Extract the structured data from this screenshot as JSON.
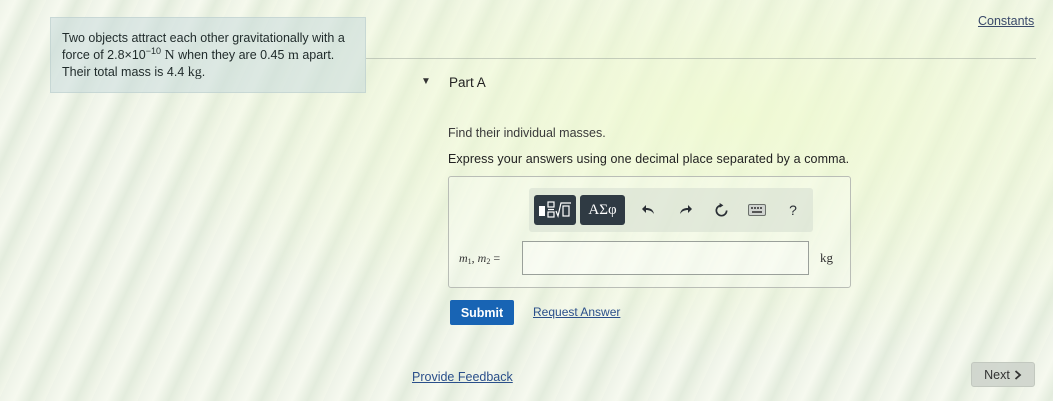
{
  "problem": {
    "line1": "Two objects attract each other gravitationally with a",
    "line2_pre": "force of 2.8×10",
    "exponent": "−10",
    "force_unit": "N",
    "line2_mid": "when they are 0.45",
    "dist_unit": "m",
    "line2_post": "apart.",
    "line3_pre": "Their total mass is 4.4",
    "mass_unit": "kg",
    "line3_post": "."
  },
  "header": {
    "constants_link": "Constants"
  },
  "part": {
    "toggle_icon": "triangle-down-icon",
    "title": "Part A",
    "instruction1": "Find their individual masses.",
    "instruction2": "Express your answers using one decimal place separated by a comma."
  },
  "toolbar": {
    "templates_icon": "templates-icon",
    "greek_label": "ΑΣφ",
    "undo_icon": "undo-icon",
    "redo_icon": "redo-icon",
    "reset_icon": "reset-icon",
    "keyboard_icon": "keyboard-icon",
    "help_label": "?"
  },
  "answer": {
    "var1": "m",
    "sub1": "1",
    "sep": ", ",
    "var2": "m",
    "sub2": "2",
    "eq": " =",
    "value": "",
    "unit": "kg"
  },
  "actions": {
    "submit_label": "Submit",
    "request_label": "Request Answer",
    "feedback_label": "Provide Feedback",
    "next_label": "Next",
    "next_icon": "chevron-right-icon"
  },
  "colors": {
    "submit_bg": "#1864b4",
    "link": "#2a4f8a",
    "toolbar_dark": "#2f3a43"
  }
}
